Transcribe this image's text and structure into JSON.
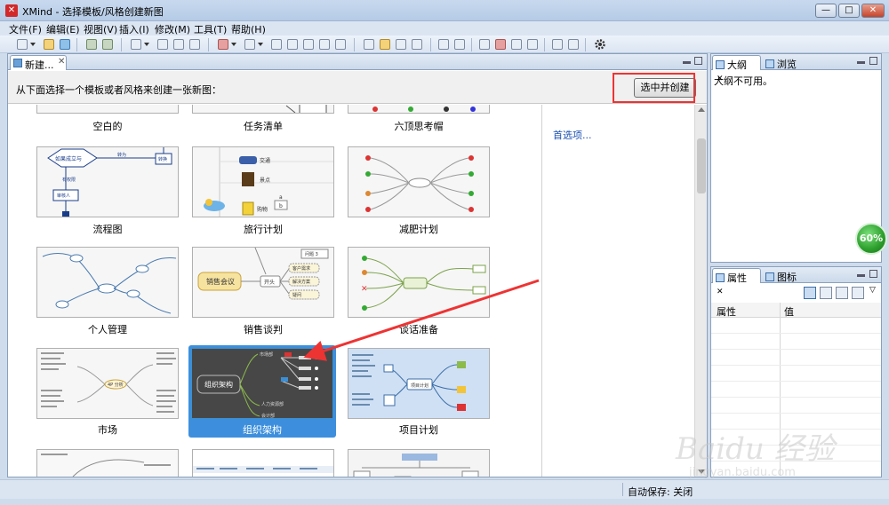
{
  "window": {
    "title": "XMind - 选择模板/风格创建新图"
  },
  "window_buttons": {
    "minimize": "—",
    "maximize": "□",
    "close": "✕"
  },
  "menu": [
    "文件(F)",
    "编辑(E)",
    "视图(V)",
    "插入(I)",
    "修改(M)",
    "工具(T)",
    "帮助(H)"
  ],
  "editor": {
    "tab_label": "新建...",
    "tab_close": "✕",
    "prompt": "从下面选择一个模板或者风格来创建一张新图：",
    "create_button": "选中并创建",
    "preferences_link": "首选项..."
  },
  "templates": [
    {
      "name": "空白的"
    },
    {
      "name": "任务清单"
    },
    {
      "name": "六顶思考帽"
    },
    {
      "name": "流程图"
    },
    {
      "name": "旅行计划"
    },
    {
      "name": "减肥计划"
    },
    {
      "name": "个人管理"
    },
    {
      "name": "销售谈判"
    },
    {
      "name": "谈话准备"
    },
    {
      "name": "市场"
    },
    {
      "name": "组织架构",
      "selected": true
    },
    {
      "name": "项目计划"
    }
  ],
  "thumb_text": {
    "flow_a": "如果成立与",
    "flow_b": "转为",
    "flow_c": "转换",
    "flow_d": "有权限",
    "flow_e": "审核人",
    "travel_a": "交通",
    "travel_b": "景点",
    "travel_c": "购物",
    "travel_d": "a",
    "travel_e": "b",
    "sales_a": "销售会议",
    "sales_b": "开头",
    "sales_c": "客户需求",
    "sales_d": "解决方案",
    "sales_e": "疑问",
    "sales_f": "问题 3",
    "org_center": "组织架构",
    "org_a": "市场部",
    "org_b": "人力资源部",
    "org_c": "会计部",
    "proj_center": "项目计划",
    "market_center": "4P 分析"
  },
  "outline_view": {
    "tabs": [
      "大纲",
      "浏览"
    ],
    "tab_close": "✕",
    "message": "大纲不可用。"
  },
  "properties_view": {
    "tabs": [
      "属性",
      "图标"
    ],
    "tab_close": "✕",
    "columns": [
      "属性",
      "值"
    ]
  },
  "status": {
    "autosave": "自动保存: 关闭"
  },
  "badge": {
    "value": "60%"
  },
  "watermark": {
    "text": "Baidu 经验",
    "sub": "jingyan.baidu.com"
  }
}
